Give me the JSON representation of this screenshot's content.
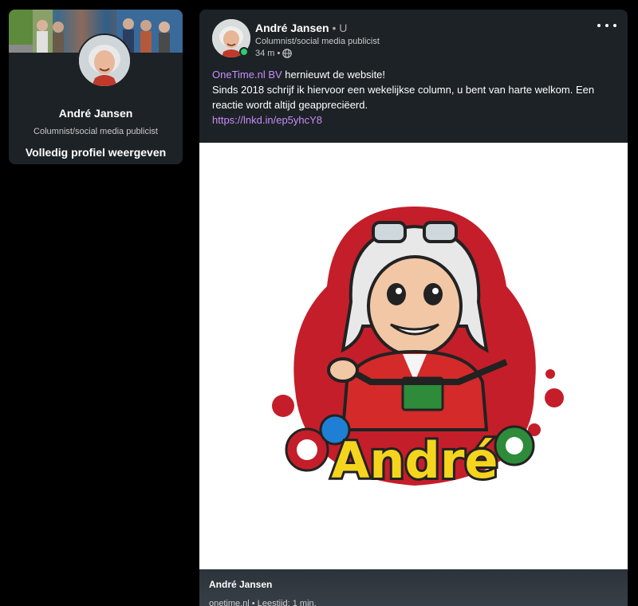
{
  "profile_card": {
    "name": "André Jansen",
    "headline": "Columnist/social media publicist",
    "view_profile_label": "Volledig profiel weergeven"
  },
  "post": {
    "author_name": "André Jansen",
    "degree": " • U",
    "headline": "Columnist/social media publicist",
    "time": "34 m •",
    "mention": "OneTime.nl BV",
    "line1_rest": " hernieuwt de website!",
    "line2": "Sinds 2018 schrijf ik hiervoor een wekelijkse column, u bent van harte welkom. Een reactie wordt altijd geappreciëerd.",
    "link": "https://lnkd.in/ep5yhcY8",
    "image_text": "André",
    "preview": {
      "title": "André Jansen",
      "meta": "onetime.nl • Leestijd: 1 min."
    }
  },
  "colors": {
    "background": "#000000",
    "card": "#1d2226",
    "link": "#c88dfa",
    "online": "#2ecc71"
  },
  "icons": [
    "globe-icon",
    "more-options-icon",
    "online-status-icon"
  ]
}
